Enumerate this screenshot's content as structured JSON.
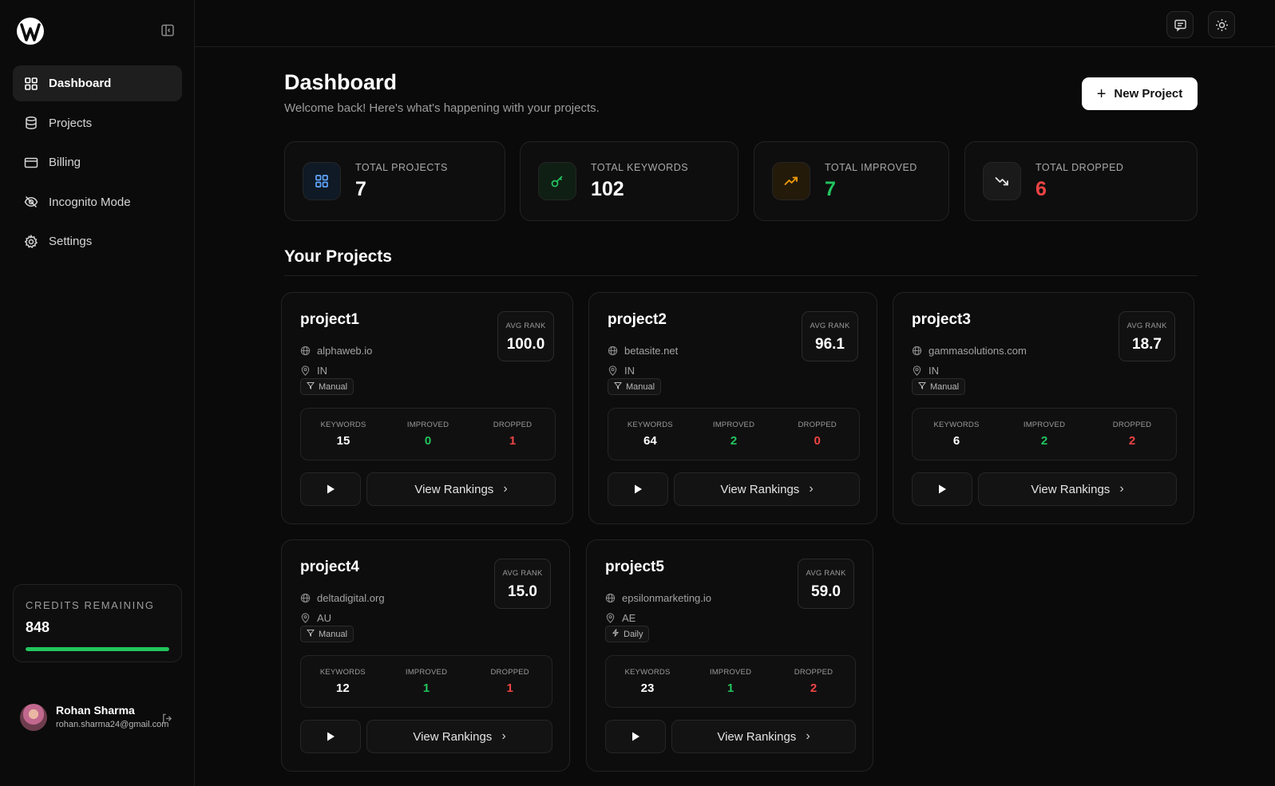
{
  "sidebar": {
    "items": [
      {
        "label": "Dashboard",
        "icon": "grid-icon",
        "active": true
      },
      {
        "label": "Projects",
        "icon": "database-icon"
      },
      {
        "label": "Billing",
        "icon": "card-icon"
      },
      {
        "label": "Incognito Mode",
        "icon": "eye-off-icon"
      },
      {
        "label": "Settings",
        "icon": "gear-icon"
      }
    ],
    "credits": {
      "label": "CREDITS REMAINING",
      "value": "848",
      "fill_fraction": 1.0
    },
    "user": {
      "name": "Rohan Sharma",
      "email": "rohan.sharma24@gmail.com"
    }
  },
  "header": {
    "title": "Dashboard",
    "subtitle": "Welcome back! Here's what's happening with your projects.",
    "new_project_label": "New Project"
  },
  "stats": [
    {
      "label": "TOTAL PROJECTS",
      "value": "7",
      "icon": "grid-icon",
      "accent": "#60a5fa"
    },
    {
      "label": "TOTAL KEYWORDS",
      "value": "102",
      "icon": "key-icon",
      "accent": "#22c55e"
    },
    {
      "label": "TOTAL IMPROVED",
      "value": "7",
      "icon": "trending-up-icon",
      "accent": "#f59e0b"
    },
    {
      "label": "TOTAL DROPPED",
      "value": "6",
      "icon": "trending-down-icon",
      "accent": "#ef4444"
    }
  ],
  "projects_section": {
    "title": "Your Projects"
  },
  "labels": {
    "avg_rank": "AVG RANK",
    "keywords": "KEYWORDS",
    "improved": "IMPROVED",
    "dropped": "DROPPED",
    "view_rankings": "View Rankings"
  },
  "projects": [
    {
      "name": "project1",
      "domain": "alphaweb.io",
      "location": "IN",
      "schedule": "Manual",
      "avg_rank": "100.0",
      "keywords": "15",
      "improved": "0",
      "dropped": "1"
    },
    {
      "name": "project2",
      "domain": "betasite.net",
      "location": "IN",
      "schedule": "Manual",
      "avg_rank": "96.1",
      "keywords": "64",
      "improved": "2",
      "dropped": "0"
    },
    {
      "name": "project3",
      "domain": "gammasolutions.com",
      "location": "IN",
      "schedule": "Manual",
      "avg_rank": "18.7",
      "keywords": "6",
      "improved": "2",
      "dropped": "2"
    },
    {
      "name": "project4",
      "domain": "deltadigital.org",
      "location": "AU",
      "schedule": "Manual",
      "avg_rank": "15.0",
      "keywords": "12",
      "improved": "1",
      "dropped": "1"
    },
    {
      "name": "project5",
      "domain": "epsilonmarketing.io",
      "location": "AE",
      "schedule": "Daily",
      "avg_rank": "59.0",
      "keywords": "23",
      "improved": "1",
      "dropped": "2"
    }
  ],
  "colors": {
    "accent_green": "#22c55e",
    "accent_red": "#ef4444",
    "background": "#0a0a0a"
  }
}
